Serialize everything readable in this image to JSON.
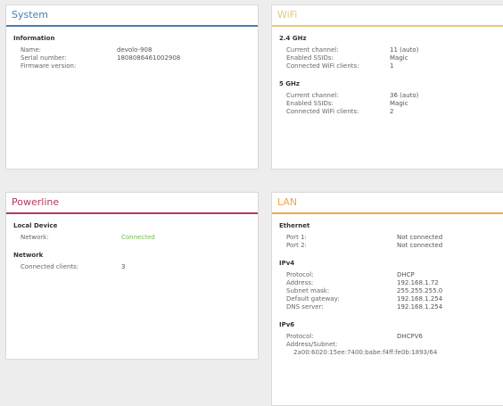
{
  "colors": {
    "system": "#4a7dad",
    "wifi": "#e5c97a",
    "powerline": "#b13a5a",
    "lan": "#f0a64a",
    "connected": "#74b94d"
  },
  "system": {
    "title": "System",
    "section": "Information",
    "rows": [
      {
        "label": "Name:",
        "value": "devolo-908"
      },
      {
        "label": "Serial number:",
        "value": "1808086461002908"
      },
      {
        "label": "Firmware version:",
        "value": ""
      }
    ]
  },
  "wifi": {
    "title": "WiFi",
    "band24": {
      "title": "2.4 GHz",
      "rows": [
        {
          "label": "Current channel:",
          "value": "11 (auto)"
        },
        {
          "label": "Enabled SSIDs:",
          "value": "Magic"
        },
        {
          "label": "Connected WiFi clients:",
          "value": "1"
        }
      ]
    },
    "band5": {
      "title": "5 GHz",
      "rows": [
        {
          "label": "Current channel:",
          "value": "36 (auto)"
        },
        {
          "label": "Enabled SSIDs:",
          "value": "Magic"
        },
        {
          "label": "Connected WiFi clients:",
          "value": "2"
        }
      ]
    }
  },
  "powerline": {
    "title": "Powerline",
    "local": {
      "title": "Local Device",
      "rows": [
        {
          "label": "Network:",
          "value": "Connected"
        }
      ]
    },
    "network": {
      "title": "Network",
      "rows": [
        {
          "label": "Connected clients:",
          "value": "3"
        }
      ]
    }
  },
  "lan": {
    "title": "LAN",
    "ethernet": {
      "title": "Ethernet",
      "rows": [
        {
          "label": "Port 1:",
          "value": "Not connected"
        },
        {
          "label": "Port 2:",
          "value": "Not connected"
        }
      ]
    },
    "ipv4": {
      "title": "IPv4",
      "rows": [
        {
          "label": "Protocol:",
          "value": "DHCP"
        },
        {
          "label": "Address:",
          "value": "192.168.1.72"
        },
        {
          "label": "Subnet mask:",
          "value": "255.255.255.0"
        },
        {
          "label": "Default gateway:",
          "value": "192.168.1.254"
        },
        {
          "label": "DNS server:",
          "value": "192.168.1.254"
        }
      ]
    },
    "ipv6": {
      "title": "IPv6",
      "rows": [
        {
          "label": "Protocol:",
          "value": "DHCPV6"
        },
        {
          "label": "Address/Subnet:",
          "value": ""
        }
      ],
      "address": "2a00:6020:15ee:7400:babe:f4ff:fe0b:1893/64"
    }
  }
}
